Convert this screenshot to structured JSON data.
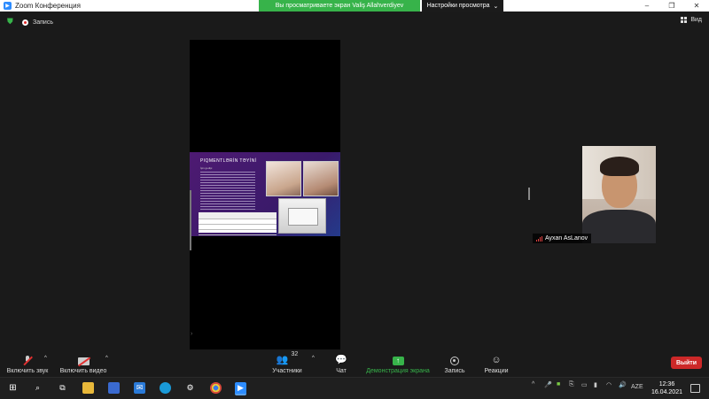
{
  "window": {
    "title": "Zoom Конференция",
    "controls": [
      "–",
      "❐",
      "✕"
    ]
  },
  "share_banner": {
    "text": "Вы просматриваете экран Valiş Allahverdiyev"
  },
  "view_options": {
    "label": "Настройки просмотра",
    "chevron": "⌄"
  },
  "top_bar": {
    "record_label": "Запись",
    "view_label": "Вид"
  },
  "slide": {
    "title": "PIQMENTLƏRİN TƏYİNİ",
    "subtitle": "İşin gedişi"
  },
  "participant": {
    "name": "Ayxan AsLanov"
  },
  "toolbar": {
    "unmute_label": "Включить звук",
    "start_video_label": "Включить видео",
    "participants_label": "Участники",
    "participants_count": "32",
    "chat_label": "Чат",
    "share_label": "Демонстрация экрана",
    "record_label": "Запись",
    "reactions_label": "Реакции",
    "leave_label": "Выйти"
  },
  "taskbar": {
    "language": "AZE",
    "time": "12:36",
    "date": "16.04.2021"
  },
  "colors": {
    "accent_green": "#37b34a",
    "leave_red": "#cc2828",
    "zoom_blue": "#2d8cff"
  }
}
